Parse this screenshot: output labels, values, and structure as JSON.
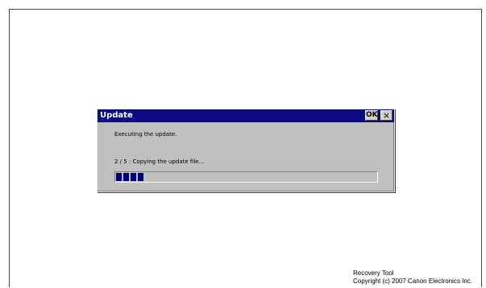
{
  "dialog": {
    "title": "Update",
    "ok_label": "OK",
    "close_label": "×",
    "message": "Executing the update.",
    "status": "2 / 5 : Copying the update file...",
    "progress": {
      "completed_segments": 4,
      "fraction": 0.12
    },
    "colors": {
      "titlebar": "#0a0a80",
      "progress_segment": "#00007a",
      "dialog_bg": "#c0c0c0"
    }
  },
  "footer": {
    "line1": "Recovery Tool",
    "line2": "Copyright (c) 2007 Canon Electronics Inc."
  }
}
